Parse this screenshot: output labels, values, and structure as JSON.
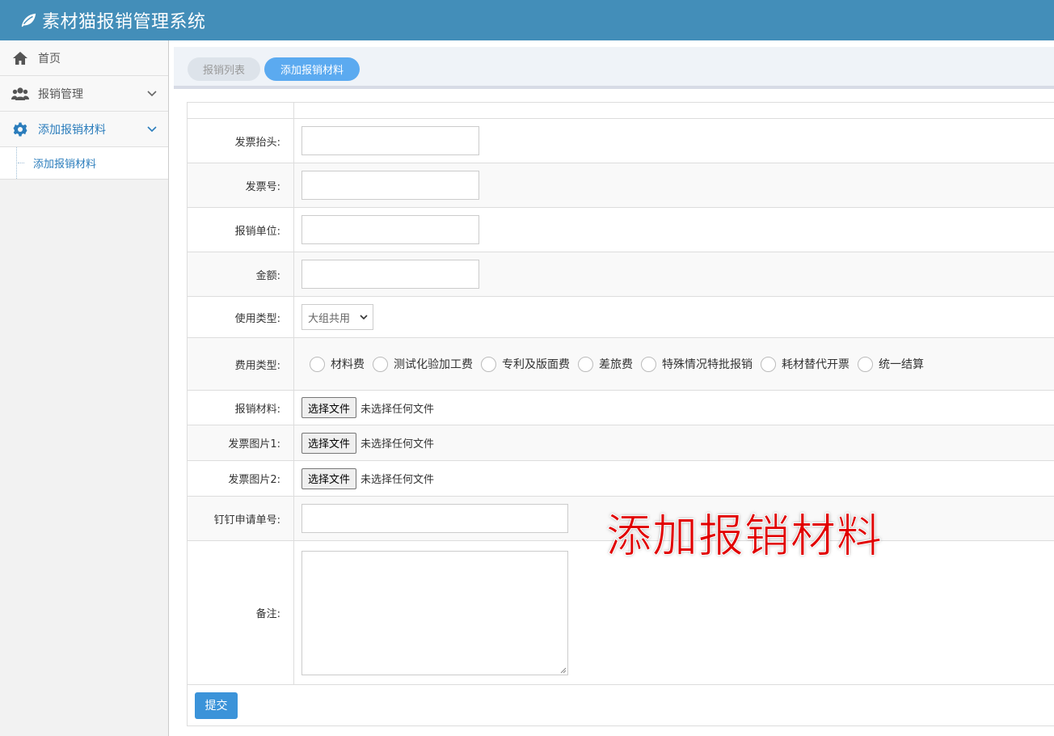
{
  "app": {
    "title": "素材猫报销管理系统",
    "logo_icon": "leaf-icon",
    "brand_color": "#438eb9"
  },
  "sidebar": {
    "items": [
      {
        "label": "首页",
        "icon": "home-icon"
      },
      {
        "label": "报销管理",
        "icon": "users-icon"
      },
      {
        "label": "添加报销材料",
        "icon": "gear-icon",
        "active": true
      }
    ],
    "sub_items": [
      {
        "label": "添加报销材料"
      }
    ]
  },
  "tabs": [
    {
      "label": "报销列表",
      "active": false
    },
    {
      "label": "添加报销材料",
      "active": true
    }
  ],
  "form": {
    "invoice_title_label": "发票抬头:",
    "invoice_no_label": "发票号:",
    "unit_label": "报销单位:",
    "amount_label": "金额:",
    "usage_type_label": "使用类型:",
    "usage_type_value": "大组共用",
    "expense_type_label": "费用类型:",
    "expense_options": [
      "材料费",
      "测试化验加工费",
      "专利及版面费",
      "差旅费",
      "特殊情况特批报销",
      "耗材替代开票",
      "统一结算"
    ],
    "material_label": "报销材料:",
    "image1_label": "发票图片1:",
    "image2_label": "发票图片2:",
    "file_button": "选择文件",
    "file_none": "未选择任何文件",
    "dingtalk_label": "钉钉申请单号:",
    "remark_label": "备注:",
    "submit_label": "提交"
  },
  "watermark": "添加报销材料"
}
